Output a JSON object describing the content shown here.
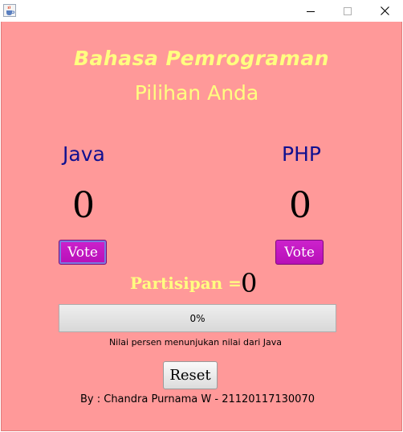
{
  "window": {
    "icon": "java-coffee-cup-icon",
    "controls": {
      "minimize": "minimize-icon",
      "maximize": "maximize-icon",
      "close": "close-icon"
    }
  },
  "header": {
    "title": "Bahasa Pemrograman",
    "subtitle": "Pilihan Anda"
  },
  "options": [
    {
      "label": "Java",
      "votes": "0",
      "vote_label": "Vote"
    },
    {
      "label": "PHP",
      "votes": "0",
      "vote_label": "Vote"
    }
  ],
  "participation": {
    "label": "Partisipan =",
    "count": "0"
  },
  "progress": {
    "value_percent": 0,
    "text": "0%",
    "note": "Nilai persen menunjukan nilai dari Java"
  },
  "actions": {
    "reset_label": "Reset"
  },
  "footer": {
    "credit": "By : Chandra Purnama W - 21120117130070"
  },
  "colors": {
    "background": "#ff9999",
    "title_yellow": "#ffff80",
    "label_navy": "#101090",
    "vote_button": "#c018c0",
    "progress_fill": "#06b025"
  }
}
